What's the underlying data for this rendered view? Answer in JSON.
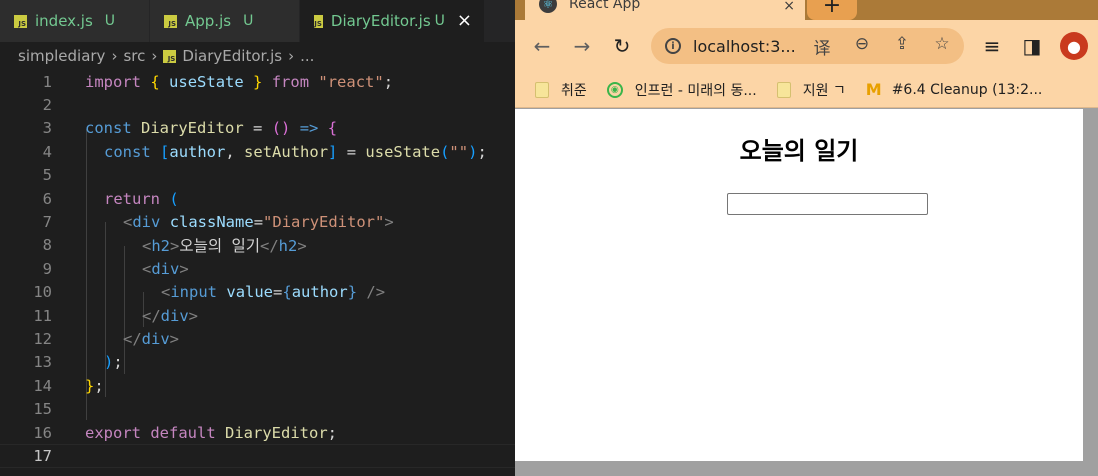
{
  "editor": {
    "tabs": [
      {
        "label": "index.js",
        "status": "U",
        "active": false
      },
      {
        "label": "App.js",
        "status": "U",
        "active": false
      },
      {
        "label": "DiaryEditor.js",
        "status": "U",
        "active": true
      }
    ],
    "close_glyph": "×",
    "breadcrumb": [
      "simplediary",
      "src",
      "DiaryEditor.js",
      "..."
    ],
    "line_numbers": [
      "1",
      "2",
      "3",
      "4",
      "5",
      "6",
      "7",
      "8",
      "9",
      "10",
      "11",
      "12",
      "13",
      "14",
      "15",
      "16",
      "17"
    ],
    "code": {
      "l1": {
        "kw1": "import",
        "b1": "{",
        "name": "useState",
        "b2": "}",
        "kw2": "from",
        "str": "\"react\"",
        "semi": ";"
      },
      "l3": {
        "kw": "const",
        "name": "DiaryEditor",
        "eq": "=",
        "paren": "()",
        "arrow": "=>",
        "brace": "{"
      },
      "l4": {
        "kw": "const",
        "lb": "[",
        "a": "author",
        "comma": ",",
        "b": "setAuthor",
        "rb": "]",
        "eq": "=",
        "fn": "useState",
        "lp": "(",
        "str": "\"\"",
        "rp": ")",
        "semi": ";"
      },
      "l6": {
        "kw": "return",
        "paren": "("
      },
      "l7": {
        "lt": "<",
        "tag": "div",
        "attr": "className",
        "eq": "=",
        "val": "\"DiaryEditor\"",
        "gt": ">"
      },
      "l8": {
        "open": "<",
        "tag": "h2",
        "gt": ">",
        "text": "오늘의 일기",
        "close_open": "</",
        "close_tag": "h2",
        "close_gt": ">"
      },
      "l9": {
        "lt": "<",
        "tag": "div",
        "gt": ">"
      },
      "l10": {
        "lt": "<",
        "tag": "input",
        "attr": "value",
        "eq": "=",
        "lb": "{",
        "var": "author",
        "rb": "}",
        "end": "/>"
      },
      "l11": {
        "lt": "</",
        "tag": "div",
        "gt": ">"
      },
      "l12": {
        "lt": "</",
        "tag": "div",
        "gt": ">"
      },
      "l13": {
        "paren": ")",
        "semi": ";"
      },
      "l14": {
        "brace": "}",
        "semi": ";"
      },
      "l16": {
        "kw1": "export",
        "kw2": "default",
        "name": "DiaryEditor",
        "semi": ";"
      }
    }
  },
  "browser": {
    "tab_title": "React App",
    "tab_close": "×",
    "new_tab": "+",
    "url": "localhost:3...",
    "avatar_glyph": "👤",
    "bookmarks": [
      {
        "label": "취준",
        "icon": "folder-icon"
      },
      {
        "label": "인프런 - 미래의 동...",
        "icon": "inflearn-icon"
      },
      {
        "label": "지원 ㄱ",
        "icon": "folder-icon"
      },
      {
        "label": "#6.4 Cleanup (13:2...",
        "icon": "nomad-logo-icon"
      }
    ],
    "page": {
      "heading": "오늘의 일기",
      "input_value": ""
    }
  },
  "colors": {
    "vscode_bg": "#1e1e1e",
    "chrome_toolbar": "#fcd5a6",
    "chrome_tabstrip": "#ab7a38",
    "git_untracked": "#73c991"
  }
}
